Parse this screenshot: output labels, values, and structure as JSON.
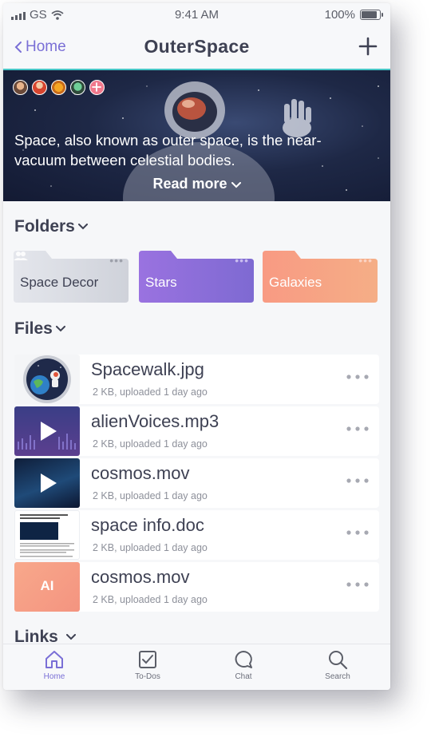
{
  "status_bar": {
    "carrier": "GS",
    "time": "9:41 AM",
    "battery": "100%"
  },
  "nav": {
    "back_label": "Home",
    "title": "OuterSpace"
  },
  "banner": {
    "description": "Space, also known as outer space, is the near-vacuum between celestial bodies.",
    "read_more": "Read more"
  },
  "folders_section": {
    "title": "Folders"
  },
  "folders": [
    {
      "name": "Space Decor",
      "color": "#d7d9e0"
    },
    {
      "name": "Stars",
      "color": "#8f73d9"
    },
    {
      "name": "Galaxies",
      "color": "#f7a081"
    }
  ],
  "files_section": {
    "title": "Files"
  },
  "files": [
    {
      "name": "Spacewalk.jpg",
      "meta": "2 KB, uploaded 1 day ago",
      "thumb": "planet-astronaut-image"
    },
    {
      "name": "alienVoices.mp3",
      "meta": "2 KB, uploaded 1 day ago",
      "thumb": "audio-play"
    },
    {
      "name": "cosmos.mov",
      "meta": "2 KB, uploaded 1 day ago",
      "thumb": "video-play"
    },
    {
      "name": "space info.doc",
      "meta": "2 KB, uploaded 1 day ago",
      "thumb": "document-preview"
    },
    {
      "name": "cosmos.mov",
      "meta": "2 KB, uploaded 1 day ago",
      "thumb": "ai-file",
      "thumb_label": "AI"
    }
  ],
  "links_section": {
    "title": "Links"
  },
  "tabs": [
    {
      "label": "Home",
      "icon": "home-icon",
      "active": true
    },
    {
      "label": "To-Dos",
      "icon": "checkbox-icon"
    },
    {
      "label": "Chat",
      "icon": "chat-bubble-icon"
    },
    {
      "label": "Search",
      "icon": "search-icon"
    }
  ],
  "colors": {
    "accent": "#7a6fd6",
    "title_text": "#3e4153",
    "meta_text": "#8d909a",
    "divider": "#47c6c6"
  }
}
